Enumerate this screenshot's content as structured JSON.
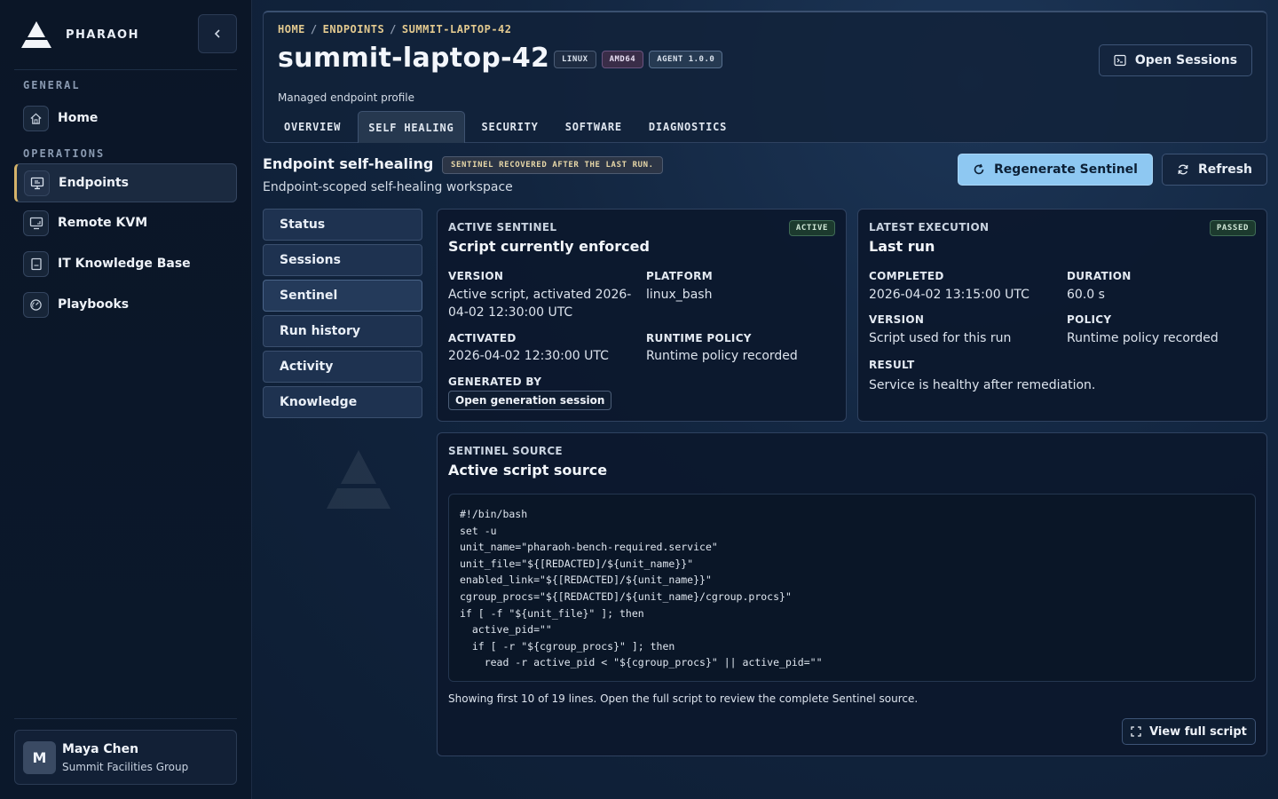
{
  "brand": {
    "name": "PHARAOH"
  },
  "sidebar": {
    "sections": [
      {
        "label": "GENERAL"
      },
      {
        "label": "OPERATIONS"
      }
    ],
    "items": [
      {
        "label": "Home",
        "icon": "home-icon"
      },
      {
        "label": "Endpoints",
        "icon": "monitor-icon",
        "active": true
      },
      {
        "label": "Remote KVM",
        "icon": "remote-screen-icon"
      },
      {
        "label": "IT Knowledge Base",
        "icon": "book-icon"
      },
      {
        "label": "Playbooks",
        "icon": "gauge-icon"
      }
    ],
    "collapse_icon": "chevron-left-icon"
  },
  "user": {
    "initial": "M",
    "name": "Maya Chen",
    "org": "Summit Facilities Group"
  },
  "header": {
    "breadcrumb": [
      "HOME",
      "ENDPOINTS",
      "SUMMIT-LAPTOP-42"
    ],
    "title": "summit-laptop-42",
    "chips": [
      "LINUX",
      "AMD64",
      "AGENT 1.0.0"
    ],
    "subtitle": "Managed endpoint profile",
    "open_sessions_label": "Open Sessions",
    "tabs": [
      {
        "label": "OVERVIEW"
      },
      {
        "label": "SELF HEALING",
        "active": true
      },
      {
        "label": "SECURITY"
      },
      {
        "label": "SOFTWARE"
      },
      {
        "label": "DIAGNOSTICS"
      }
    ]
  },
  "section": {
    "title": "Endpoint self-healing",
    "badge": "SENTINEL RECOVERED AFTER THE LAST RUN.",
    "subtitle": "Endpoint-scoped self-healing workspace",
    "regenerate_label": "Regenerate Sentinel",
    "refresh_label": "Refresh"
  },
  "side_tabs": [
    {
      "label": "Status"
    },
    {
      "label": "Sessions"
    },
    {
      "label": "Sentinel",
      "active": true
    },
    {
      "label": "Run history"
    },
    {
      "label": "Activity"
    },
    {
      "label": "Knowledge"
    }
  ],
  "active_sentinel": {
    "label": "ACTIVE SENTINEL",
    "title": "Script currently enforced",
    "status": "ACTIVE",
    "version_label": "VERSION",
    "version_value": "Active script, activated 2026-04-02 12:30:00 UTC",
    "version_line1": "Active script, activated 2026-",
    "version_line2": "04-02 12:30:00 UTC",
    "platform_label": "PLATFORM",
    "platform_value": "linux_bash",
    "activated_label": "ACTIVATED",
    "activated_value": "2026-04-02 12:30:00 UTC",
    "runtime_label": "RUNTIME POLICY",
    "runtime_value": "Runtime policy recorded",
    "generated_label": "GENERATED BY",
    "generated_button": "Open generation session"
  },
  "latest_execution": {
    "label": "LATEST EXECUTION",
    "title": "Last run",
    "status": "PASSED",
    "completed_label": "COMPLETED",
    "completed_value": "2026-04-02 13:15:00 UTC",
    "duration_label": "DURATION",
    "duration_value": "60.0 s",
    "version_label": "VERSION",
    "version_value": "Script used for this run",
    "policy_label": "POLICY",
    "policy_value": "Runtime policy recorded",
    "result_label": "RESULT",
    "result_value": "Service is healthy after remediation."
  },
  "source": {
    "label": "SENTINEL SOURCE",
    "title": "Active script source",
    "lines": [
      "#!/bin/bash",
      "set -u",
      "unit_name=\"pharaoh-bench-required.service\"",
      "unit_file=\"${[REDACTED]/${unit_name}}\"",
      "enabled_link=\"${[REDACTED]/${unit_name}}\"",
      "cgroup_procs=\"${[REDACTED]/${unit_name}/cgroup.procs}\"",
      "if [ -f \"${unit_file}\" ]; then",
      "  active_pid=\"\"",
      "  if [ -r \"${cgroup_procs}\" ]; then",
      "    read -r active_pid < \"${cgroup_procs}\" || active_pid=\"\""
    ],
    "note": "Showing first 10 of 19 lines. Open the full script to review the complete Sentinel source.",
    "view_label": "View full script"
  }
}
